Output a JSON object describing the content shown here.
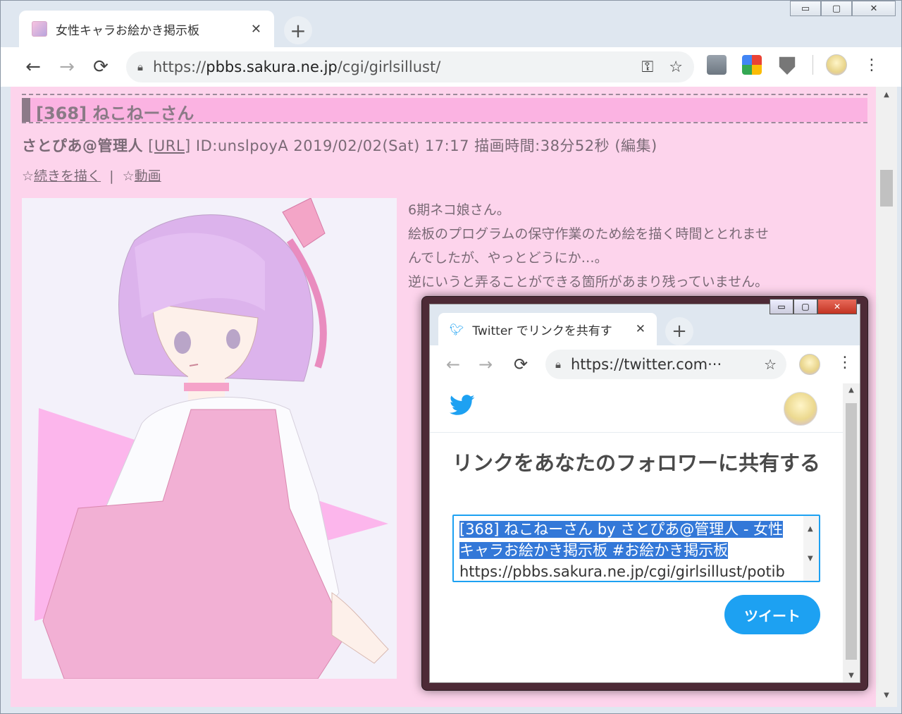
{
  "browser": {
    "tab": {
      "title": "女性キャラお絵かき掲示板",
      "close": "✕"
    },
    "new_tab": "+",
    "controls": {
      "minimize": "▭",
      "maximize": "▢",
      "close": "✕"
    },
    "url": {
      "scheme": "https://",
      "host": "pbbs.sakura.ne.jp",
      "path": "/cgi/girlsillust/"
    },
    "nav": {
      "back": "←",
      "forward": "→",
      "reload": "⟳"
    },
    "key_icon": "⚿",
    "star_icon": "☆",
    "menu": "⋮"
  },
  "post": {
    "heading": "[368] ねこねーさん",
    "author": "さとぴあ@管理人",
    "url_link": "URL",
    "meta_rest": "ID:unslpoyA  2019/02/02(Sat) 17:17  描画時間:38分52秒",
    "edit_link": "編集",
    "continue_link": "続きを描く",
    "video_link": "動画",
    "body_lines": [
      "6期ネコ娘さん。",
      "絵板のプログラムの保守作業のため絵を描く時間ととれませ",
      "んでしたが、やっとどうにか…。",
      "逆にいうと弄ることができる箇所があまり残っていません。"
    ]
  },
  "popup": {
    "tab_title": "Twitter でリンクを共有す",
    "tab_close": "✕",
    "new_tab": "+",
    "controls": {
      "minimize": "▭",
      "maximize": "▢",
      "close": "✕"
    },
    "url": "https://twitter.com···",
    "nav": {
      "back": "←",
      "forward": "→",
      "reload": "⟳"
    },
    "star": "☆",
    "menu": "⋮",
    "share_title": "リンクをあなたのフォロワーに共有する",
    "tweet_selected_1": "[368] ねこねーさん by さとぴあ@管理人 - 女性",
    "tweet_selected_2": "キャラお絵かき掲示板 #お絵かき掲示板",
    "tweet_url": "https://pbbs.sakura.ne.jp/cgi/girlsillust/potib",
    "tweet_button": "ツイート"
  },
  "colors": {
    "page_bg": "#fdd4ec",
    "heading_bar": "#fbb3e2",
    "twitter_blue": "#1da1f2",
    "selection": "#3378d8"
  }
}
